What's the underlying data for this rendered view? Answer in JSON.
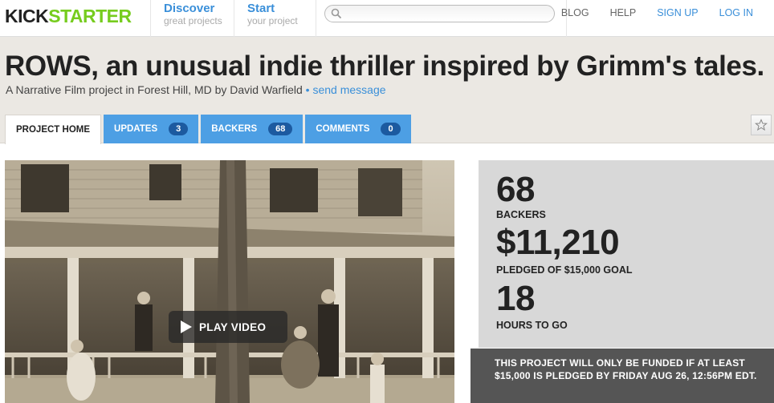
{
  "header": {
    "logo_part1": "KICK",
    "logo_part2": "STARTER",
    "discover_title": "Discover",
    "discover_sub": "great projects",
    "start_title": "Start",
    "start_sub": "your project",
    "search_placeholder": "",
    "links": [
      "BLOG",
      "HELP",
      "SIGN UP",
      "LOG IN"
    ]
  },
  "project": {
    "title": "ROWS, an unusual indie thriller inspired by Grimm's tales.",
    "subtitle": "A Narrative Film project in Forest Hill, MD by David Warfield",
    "bullet": " • ",
    "send_message": "send message"
  },
  "tabs": [
    {
      "label": "PROJECT HOME",
      "count": null
    },
    {
      "label": "UPDATES",
      "count": "3"
    },
    {
      "label": "BACKERS",
      "count": "68"
    },
    {
      "label": "COMMENTS",
      "count": "0"
    }
  ],
  "video": {
    "play_label": "PLAY VIDEO"
  },
  "stats": {
    "backers": "68",
    "backers_label": "BACKERS",
    "pledged": "$11,210",
    "pledged_label": "PLEDGED OF $15,000 GOAL",
    "hours": "18",
    "hours_label": "HOURS TO GO"
  },
  "notice": "THIS PROJECT WILL ONLY BE FUNDED IF AT LEAST $15,000 IS PLEDGED BY FRIDAY AUG 26, 12:56PM EDT."
}
